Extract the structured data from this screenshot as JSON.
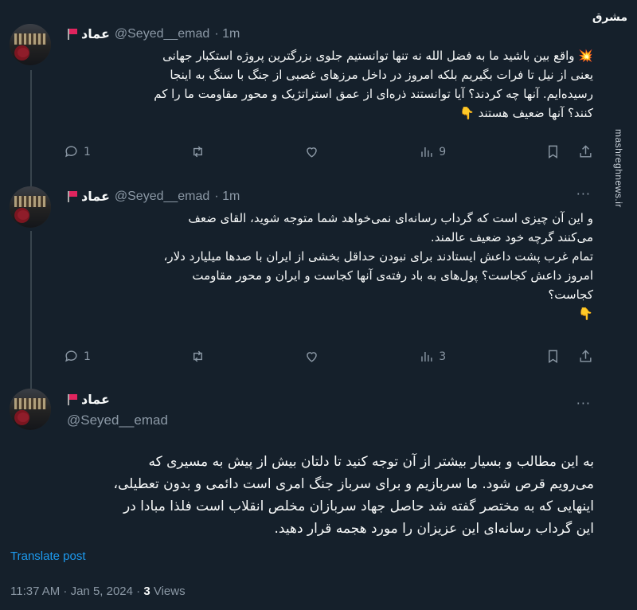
{
  "author": {
    "name": "عماد",
    "handle": "@Seyed__emad"
  },
  "tweets": [
    {
      "time": "· 1m",
      "text": "💥 واقع بین باشید ما به فضل الله نه تنها توانستیم جلوی بزرگترین پروژه استکبار جهانی\nیعنی از نیل تا فرات بگیریم بلکه امروز در داخل مرزهای غصبی از جنگ با سنگ به اینجا\nرسیده‌ایم. آنها چه کردند؟ آیا توانستند ذره‌ای از عمق استراتژیک و محور مقاومت ما را کم\nکنند؟ آنها ضعیف هستند 👇",
      "replies": "1",
      "retweets": "",
      "likes": "",
      "views": "9"
    },
    {
      "time": "· 1m",
      "text": "و این آن چیزی است که گرداب رسانه‌ای نمی‌خواهد شما متوجه شوید، القای ضعف\nمی‌کنند گرچه خود ضعیف عالمند.\nتمام غرب پشت داعش ایستادند برای نبودن حداقل بخشی از ایران با صدها میلیارد دلار،\nامروز داعش کجاست؟ پول‌های به باد رفته‌ی آنها کجاست و ایران و محور مقاومت\nکجاست؟\n👇",
      "replies": "1",
      "retweets": "",
      "likes": "",
      "views": "3"
    },
    {
      "text": "به این مطالب و بسیار بیشتر از آن توجه کنید تا دلتان بیش از پیش به مسیری که\nمی‌رویم قرص شود. ما سربازیم و برای سرباز جنگ امری است دائمی و بدون تعطیلی،\nاینهایی که به مختصر گفته شد حاصل جهاد سربازان مخلص انقلاب است فلذا مبادا در\nاین گرداب رسانه‌ای این عزیزان را مورد هجمه قرار دهید."
    }
  ],
  "translate_label": "Translate post",
  "meta": {
    "time_date": "11:37 AM · Jan 5, 2024 ·",
    "views_count": "3",
    "views_label": "Views"
  },
  "watermark": {
    "logo": "مشرق",
    "url": "mashreghnews.ir"
  },
  "icons": [
    "reply-icon",
    "retweet-icon",
    "like-icon",
    "views-icon",
    "bookmark-icon",
    "share-icon",
    "more-icon"
  ],
  "colors": {
    "background": "#15202b",
    "accent": "#1d9bf0",
    "muted": "#8b98a5",
    "flag": "#e0245e"
  }
}
